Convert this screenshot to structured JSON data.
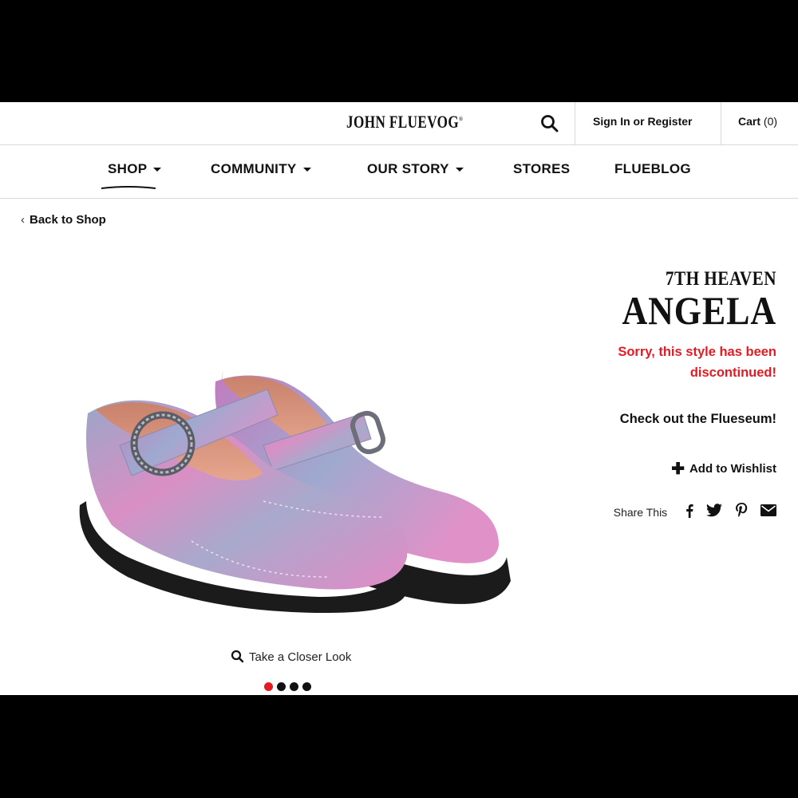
{
  "header": {
    "logo": "JOHN FLUEVOG",
    "logo_mark": "®",
    "signin_label": "Sign In or Register",
    "cart_label": "Cart",
    "cart_count": "(0)"
  },
  "nav": {
    "items": [
      {
        "label": "SHOP",
        "has_dropdown": true,
        "active": true
      },
      {
        "label": "COMMUNITY",
        "has_dropdown": true
      },
      {
        "label": "OUR STORY",
        "has_dropdown": true
      },
      {
        "label": "STORES",
        "has_dropdown": false
      },
      {
        "label": "FLUEBLOG",
        "has_dropdown": false
      }
    ]
  },
  "back_link": "Back to Shop",
  "product": {
    "collection": "7TH HEAVEN",
    "name": "ANGELA",
    "status_line1": "Sorry, this style has been",
    "status_line2": "discontinued!",
    "flueseum_link": "Check out the Flueseum!",
    "wishlist_label": "Add to Wishlist",
    "share_label": "Share This",
    "share_icons": [
      "facebook-icon",
      "twitter-icon",
      "pinterest-icon",
      "email-icon"
    ],
    "image_alt": "Pink and silver Mary Jane brogue shoes with buckle"
  },
  "gallery": {
    "closer_look_label": "Take a Closer Look",
    "dot_count": 4,
    "active_dot": 1
  },
  "colors": {
    "accent_red": "#e31b23",
    "text": "#111111",
    "border": "#d9d9d9"
  }
}
